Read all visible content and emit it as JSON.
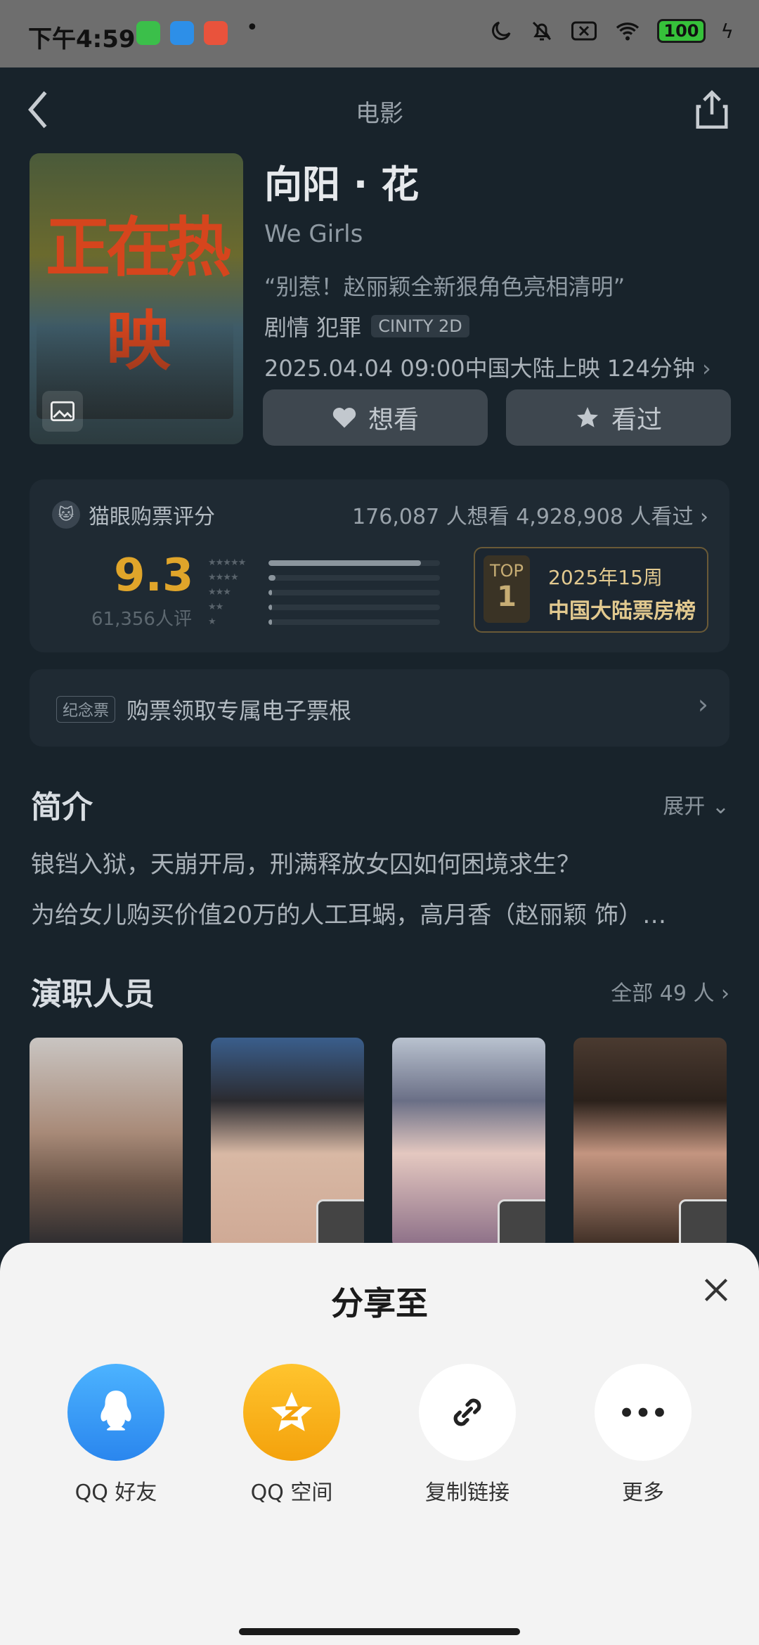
{
  "status": {
    "time": "下午4:59",
    "battery": "100"
  },
  "nav": {
    "title": "电影"
  },
  "movie": {
    "title": "向阳 · 花",
    "english": "We Girls",
    "slogan": "“别惹！赵丽颖全新狠角色亮相清明”",
    "genres": "剧情 犯罪",
    "format_badge": "CINITY 2D",
    "release": "2025.04.04 09:00中国大陆上映 124分钟",
    "poster_text": "正在热映",
    "want_label": "想看",
    "watched_label": "看过"
  },
  "rating": {
    "source": "猫眼购票评分",
    "counts": "176,087 人想看  4,928,908 人看过",
    "score": "9.3",
    "reviews": "61,356人评",
    "distribution": [
      0.89,
      0.04,
      0.02,
      0.01,
      0.02
    ],
    "top_tag": "TOP",
    "top_rank": "1",
    "week": "2025年15周",
    "board": "中国大陆票房榜"
  },
  "ticket": {
    "tag": "纪念票",
    "text": "购票领取专属电子票根"
  },
  "intro": {
    "title": "简介",
    "expand": "展开",
    "line1": "锒铛入狱，天崩开局，刑满释放女囚如何困境求生？",
    "line2": "为给女儿购买价值20万的人工耳蜗，高月香（赵丽颖 饰）…"
  },
  "cast": {
    "title": "演职人员",
    "more": "全部 49 人"
  },
  "share": {
    "title": "分享至",
    "items": [
      {
        "label": "QQ 好友",
        "icon": "qq-icon",
        "color": "#3b9af5"
      },
      {
        "label": "QQ 空间",
        "icon": "qzone-star-icon",
        "color": "#f5b315"
      },
      {
        "label": "复制链接",
        "icon": "link-icon",
        "color": "#ffffff"
      },
      {
        "label": "更多",
        "icon": "more-dots-icon",
        "color": "#ffffff"
      }
    ]
  }
}
